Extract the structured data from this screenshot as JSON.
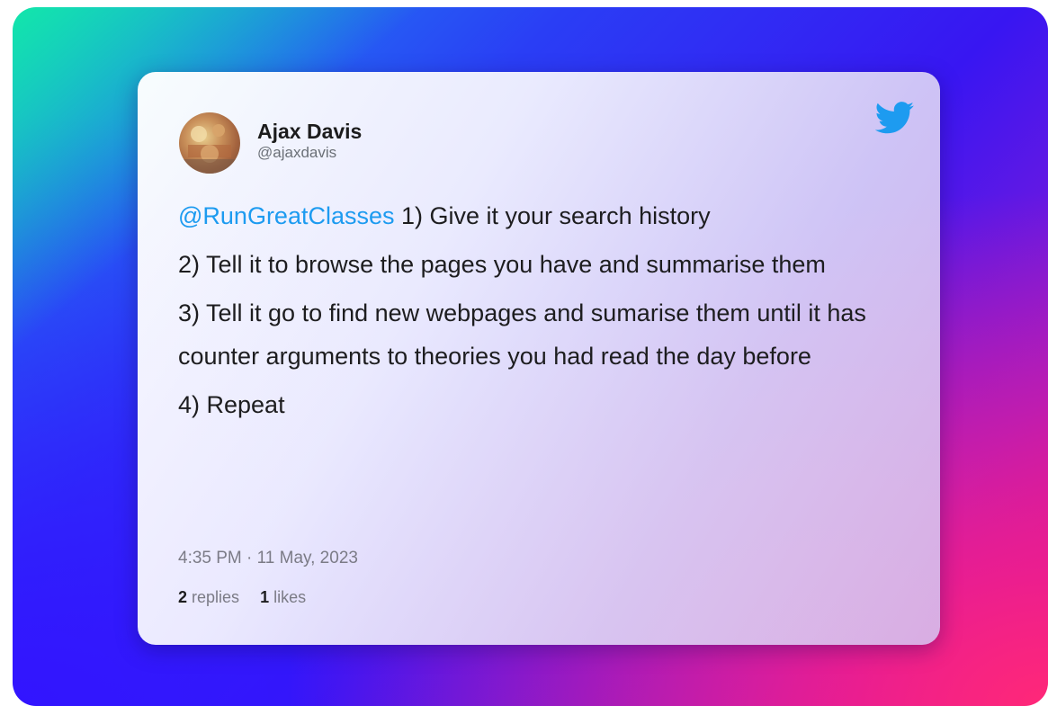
{
  "tweet": {
    "author_name": "Ajax Davis",
    "author_handle": "@ajaxdavis",
    "mention": "@RunGreatClasses",
    "line1_rest": " 1) Give it your search history",
    "line2": "2) Tell it to browse the pages you have and summarise them",
    "line3": "3) Tell it go to find new webpages and sumarise them until it has counter arguments to theories you had read the day before",
    "line4": "4) Repeat",
    "timestamp": "4:35 PM · 11 May, 2023",
    "replies_count": "2",
    "replies_label": "replies",
    "likes_count": "1",
    "likes_label": "likes"
  },
  "colors": {
    "mention": "#1d9bf0",
    "twitter_brand": "#1d9bf0",
    "text": "#1d1d1f",
    "muted": "#7b7b86"
  },
  "icons": {
    "brand": "twitter-bird-icon",
    "avatar": "avatar-image"
  }
}
